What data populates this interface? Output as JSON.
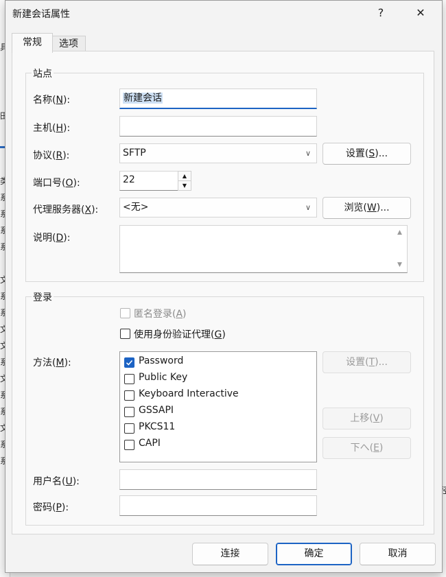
{
  "background": {
    "left_glyphs": [
      "具",
      "田",
      "类",
      "系",
      "系",
      "系",
      "系",
      "文",
      "系",
      "系",
      "文",
      "文",
      "系",
      "文",
      "系",
      "系",
      "文",
      "系",
      "系",
      "系",
      "文",
      "系"
    ],
    "right_glyph": "径"
  },
  "dialog": {
    "title": "新建会话属性",
    "help_label": "?",
    "close_label": "✕",
    "tabs": [
      {
        "label": "常规",
        "active": true
      },
      {
        "label": "选项",
        "active": false
      }
    ]
  },
  "station": {
    "group_title": "站点",
    "name_label": "名称(",
    "name_key": "N",
    "name_value": "新建会话",
    "host_label": "主机(",
    "host_key": "H",
    "host_value": "",
    "protocol_label": "协议(",
    "protocol_key": "R",
    "protocol_value": "SFTP",
    "settings_btn": "设置(",
    "settings_key": "S",
    "settings_tail": ")...",
    "port_label": "端口号(",
    "port_key": "O",
    "port_value": "22",
    "proxy_label": "代理服务器(",
    "proxy_key": "X",
    "proxy_value": "<无>",
    "browse_btn": "浏览(",
    "browse_key": "W",
    "browse_tail": ")...",
    "desc_label": "说明(",
    "desc_key": "D",
    "desc_value": "",
    "close_paren": "):"
  },
  "login": {
    "group_title": "登录",
    "anonymous_label": "匿名登录(",
    "anonymous_key": "A",
    "agent_label": "使用身份验证代理(",
    "agent_key": "G",
    "paren_close": ")",
    "method_label": "方法(",
    "method_key": "M",
    "methods": [
      {
        "label": "Password",
        "checked": true
      },
      {
        "label": "Public Key",
        "checked": false
      },
      {
        "label": "Keyboard Interactive",
        "checked": false
      },
      {
        "label": "GSSAPI",
        "checked": false
      },
      {
        "label": "PKCS11",
        "checked": false
      },
      {
        "label": "CAPI",
        "checked": false
      }
    ],
    "method_settings_btn": "设置(",
    "method_settings_key": "T",
    "move_up_btn": "上移(",
    "move_up_key": "V",
    "move_down_btn": "下へ(",
    "move_down_key": "E",
    "username_label": "用户名(",
    "username_key": "U",
    "username_value": "",
    "password_label": "密码(",
    "password_key": "P",
    "password_value": ""
  },
  "footer": {
    "connect_btn": "连接",
    "ok_btn": "确定",
    "cancel_btn": "取消"
  },
  "colors": {
    "accent": "#1c63c4",
    "selection": "#cfe1f5"
  }
}
